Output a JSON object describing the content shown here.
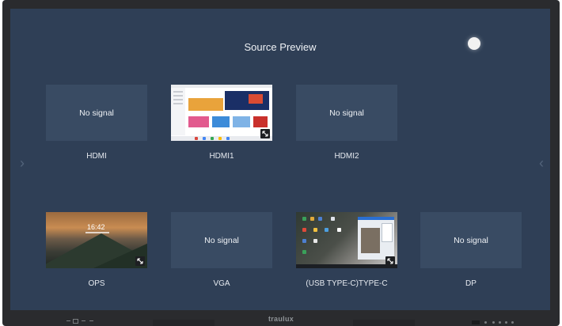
{
  "screen": {
    "title": "Source Preview"
  },
  "sources": [
    {
      "label": "HDMI",
      "status": "No signal"
    },
    {
      "label": "HDMI1",
      "status": ""
    },
    {
      "label": "HDMI2",
      "status": "No signal"
    },
    {
      "label": "OPS",
      "status": ""
    },
    {
      "label": "VGA",
      "status": "No signal"
    },
    {
      "label": "(USB TYPE-C)TYPE-C",
      "status": ""
    },
    {
      "label": "DP",
      "status": "No signal"
    }
  ],
  "ops_thumbnail": {
    "clock": "16:42"
  },
  "bezel": {
    "brand": "traulux"
  },
  "colors": {
    "screen_bg": "#2f3f56",
    "tile_bg": "#394b63",
    "text": "#eef1f5",
    "bezel": "#2a2b2e"
  },
  "icons": {
    "expand": "expand-icon",
    "close": "close-dot",
    "left_arrow": "chevron-left-icon",
    "right_arrow": "chevron-right-icon"
  }
}
